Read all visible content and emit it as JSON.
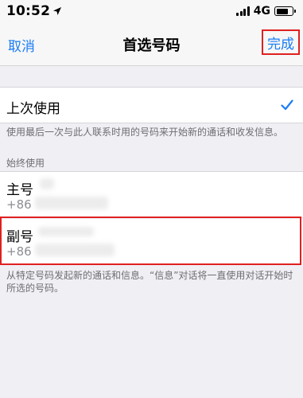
{
  "status_bar": {
    "time": "10:52",
    "network": "4G",
    "location_icon": "location-arrow-icon",
    "signal_icon": "signal-bars-icon",
    "battery_icon": "battery-icon"
  },
  "nav": {
    "cancel_label": "取消",
    "title": "首选号码",
    "done_label": "完成"
  },
  "last_used": {
    "label": "上次使用",
    "checked": true,
    "check_icon": "checkmark-icon",
    "footer": "使用最后一次与此人联系时用的号码来开始新的通话和收发信息。"
  },
  "always_use": {
    "header": "始终使用",
    "options": [
      {
        "title": "主号",
        "number": "+86"
      },
      {
        "title": "副号",
        "number": "+86"
      }
    ],
    "footer": "从特定号码发起新的通话和信息。“信息”对话将一直使用对话开始时所选的号码。"
  },
  "colors": {
    "accent": "#1a7cf5",
    "annotation_red": "#e02020",
    "background": "#efeff4",
    "secondary_text": "#6d6d72"
  }
}
